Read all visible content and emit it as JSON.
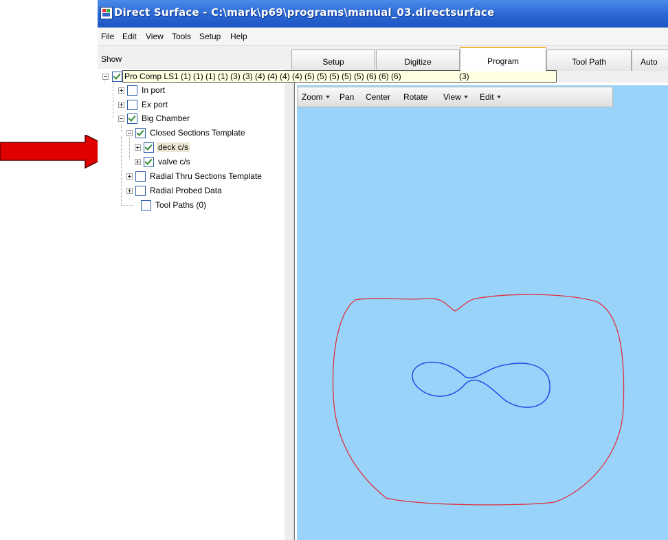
{
  "window": {
    "title": "Direct Surface - C:\\mark\\p69\\programs\\manual_03.directsurface"
  },
  "menu": [
    "File",
    "Edit",
    "View",
    "Tools",
    "Setup",
    "Help"
  ],
  "show_label": "Show",
  "tabs": [
    {
      "label": "Setup",
      "active": false
    },
    {
      "label": "Digitize",
      "active": false
    },
    {
      "label": "Program",
      "active": true
    },
    {
      "label": "Tool Path",
      "active": false
    },
    {
      "label": "Auto",
      "active": false
    }
  ],
  "tree": {
    "root_tooltip": "Pro Comp LS1 (1) (1) (1) (1) (3) (3) (4) (4) (4) (4) (5) (5) (5) (5) (5) (6) (6) (6)",
    "root_tooltip_count": "(3)",
    "nodes": [
      {
        "label": "In port",
        "checked": false
      },
      {
        "label": "Ex port",
        "checked": false
      },
      {
        "label": "Big Chamber",
        "checked": true
      },
      {
        "label": "Closed Sections Template",
        "checked": true
      },
      {
        "label": "deck c/s",
        "checked": true,
        "selected": true
      },
      {
        "label": "valve c/s",
        "checked": true
      },
      {
        "label": "Radial Thru Sections Template",
        "checked": false
      },
      {
        "label": "Radial Probed Data",
        "checked": false
      },
      {
        "label": "Tool Paths (0)",
        "checked": false
      }
    ]
  },
  "canvas_toolbar": {
    "zoom": "Zoom",
    "pan": "Pan",
    "center": "Center",
    "rotate": "Rotate",
    "view": "View",
    "edit": "Edit"
  },
  "colors": {
    "canvas_bg": "#99d3f9",
    "outer_contour": "#e0303c",
    "inner_contour": "#1f4ee8",
    "annotation_arrow": "#e00000",
    "titlebar": "#2a66d4",
    "active_tab_accent": "#f2b53b"
  }
}
